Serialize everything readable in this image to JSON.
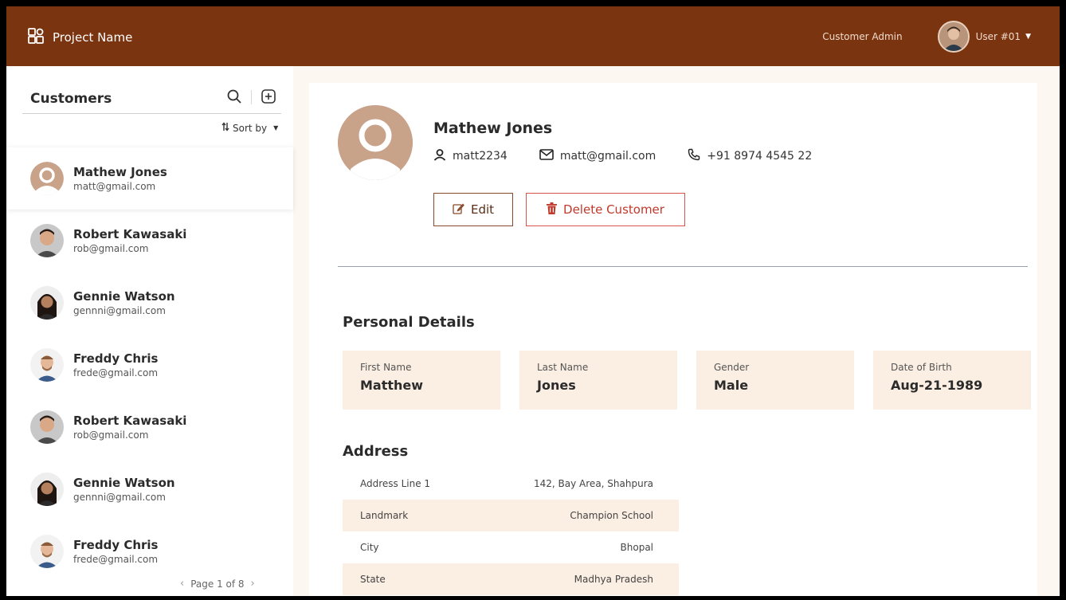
{
  "app": {
    "title": "Project Name",
    "role": "Customer Admin",
    "user_label": "User #01"
  },
  "sidebar": {
    "title": "Customers",
    "sort_label": "Sort by",
    "customers": [
      {
        "name": "Mathew Jones",
        "email": "matt@gmail.com",
        "active": true
      },
      {
        "name": "Robert Kawasaki",
        "email": "rob@gmail.com"
      },
      {
        "name": "Gennie Watson",
        "email": "gennni@gmail.com"
      },
      {
        "name": "Freddy Chris",
        "email": "frede@gmail.com"
      },
      {
        "name": "Robert Kawasaki",
        "email": "rob@gmail.com"
      },
      {
        "name": "Gennie Watson",
        "email": "gennni@gmail.com"
      },
      {
        "name": "Freddy Chris",
        "email": "frede@gmail.com"
      }
    ],
    "pager": "Page 1 of 8"
  },
  "profile": {
    "name": "Mathew Jones",
    "username": "matt2234",
    "email": "matt@gmail.com",
    "phone": "+91 8974 4545 22",
    "edit_label": "Edit",
    "delete_label": "Delete Customer"
  },
  "personal": {
    "title": "Personal Details",
    "fields": [
      {
        "label": "First Name",
        "value": "Matthew"
      },
      {
        "label": "Last Name",
        "value": "Jones"
      },
      {
        "label": "Gender",
        "value": "Male"
      },
      {
        "label": "Date of Birth",
        "value": "Aug-21-1989"
      }
    ]
  },
  "address": {
    "title": "Address",
    "rows": [
      {
        "label": "Address Line 1",
        "value": "142, Bay Area, Shahpura"
      },
      {
        "label": "Landmark",
        "value": "Champion School"
      },
      {
        "label": "City",
        "value": "Bhopal"
      },
      {
        "label": "State",
        "value": "Madhya Pradesh"
      }
    ]
  },
  "colors": {
    "header": "#7a3410",
    "accent_bg": "#fbeee2",
    "danger": "#c0392b"
  }
}
